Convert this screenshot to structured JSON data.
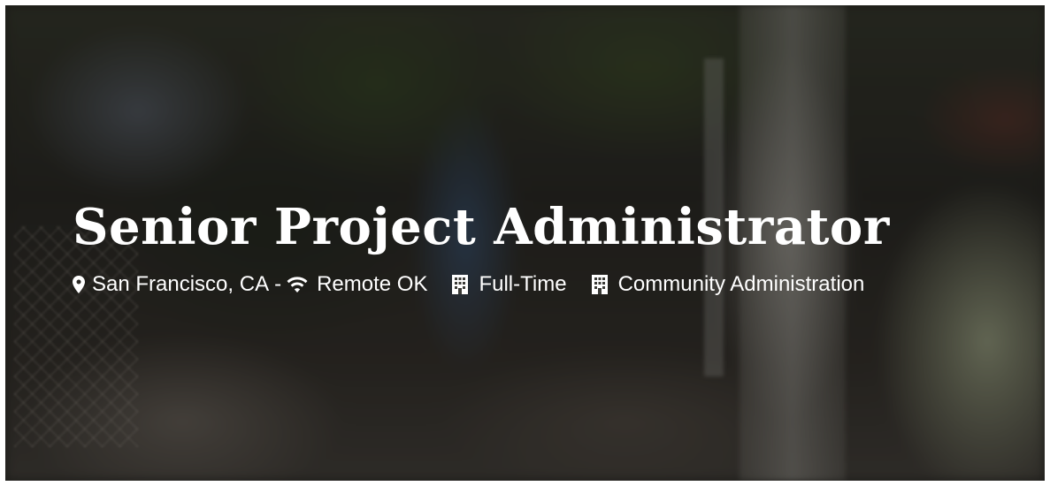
{
  "hero": {
    "title": "Senior Project Administrator",
    "location": "San Francisco, CA",
    "separator": "-",
    "remote": "Remote OK",
    "employment_type": "Full-Time",
    "department": "Community Administration",
    "icons": {
      "location": "map-pin-icon",
      "remote": "wifi-icon",
      "employment_type": "building-icon",
      "department": "building-icon"
    },
    "text_color": "#ffffff"
  }
}
